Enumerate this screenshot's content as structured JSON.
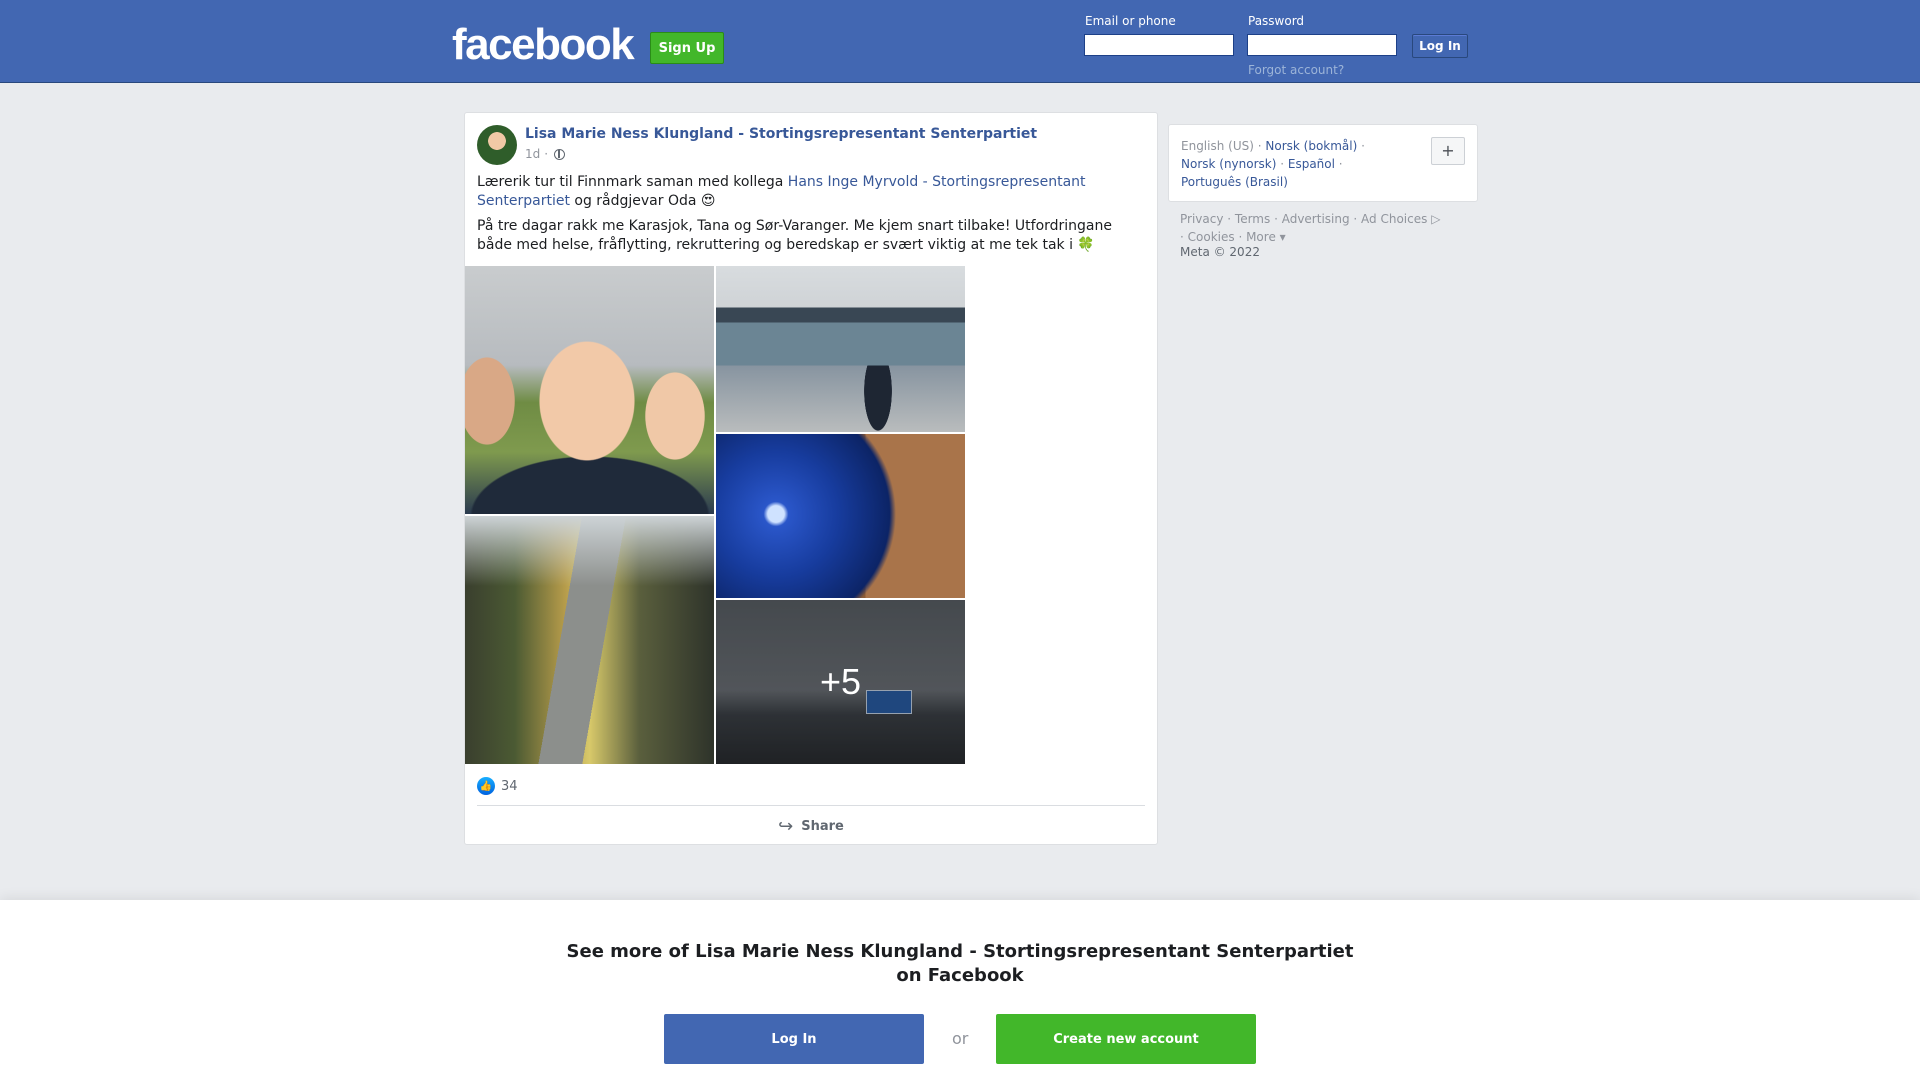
{
  "header": {
    "logo_text": "facebook",
    "signup_label": "Sign Up",
    "email_label": "Email or phone",
    "password_label": "Password",
    "login_label": "Log In",
    "forgot_label": "Forgot account?"
  },
  "post": {
    "author": "Lisa Marie Ness Klungland - Stortingsrepresentant Senterpartiet",
    "time": "1d",
    "time_separator": "·",
    "privacy_icon": "globe-icon",
    "text_line1_prefix": "Lærerik tur til Finnmark saman med kollega ",
    "mention": "Hans Inge Myrvold - Stortingsrepresentant Senterpartiet",
    "text_line1_suffix": " og rådgjevar Oda 😍",
    "text_line2": "På tre dagar rakk me Karasjok, Tana og Sør-Varanger. Me kjem snart tilbake! Utfordringane både med helse, fråflytting, rekruttering og beredskap er svært viktig at me tek tak i 🍀",
    "photos_more": "+5",
    "like_icon": "like-icon",
    "like_count": "34",
    "share_label": "Share"
  },
  "sidebar": {
    "languages": [
      {
        "label": "English (US)",
        "current": true
      },
      {
        "label": "Norsk (bokmål)",
        "current": false
      },
      {
        "label": "Norsk (nynorsk)",
        "current": false
      },
      {
        "label": "Español",
        "current": false
      },
      {
        "label": "Português (Brasil)",
        "current": false
      }
    ],
    "add_language": "+",
    "footer_links": [
      "Privacy",
      "Terms",
      "Advertising",
      "Ad Choices",
      "Cookies",
      "More"
    ],
    "copyright": "Meta © 2022"
  },
  "bottom": {
    "title": "See more of Lisa Marie Ness Klungland - Stortingsrepresentant Senterpartiet on Facebook",
    "login_label": "Log In",
    "or_label": "or",
    "create_label": "Create new account"
  },
  "colors": {
    "brand_blue": "#4267b2",
    "brand_green": "#42b72a",
    "link_blue": "#385898"
  }
}
